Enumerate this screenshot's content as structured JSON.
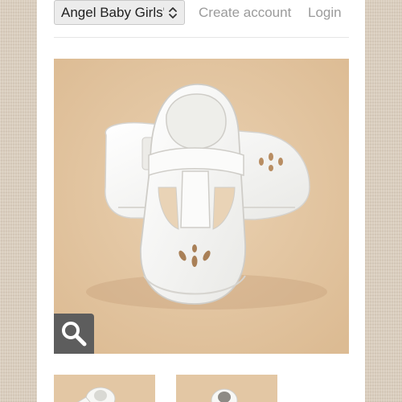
{
  "header": {
    "collection_select": {
      "selected": "Angel Baby Girls' Dot..."
    },
    "create_account_label": "Create account",
    "login_label": "Login"
  },
  "product_gallery": {
    "main_image": {
      "icon": "baby-tstrap-shoes-photo"
    },
    "zoom_icon": "magnifier-icon",
    "thumbnails": [
      {
        "icon": "shoe-thumbnail-1"
      },
      {
        "icon": "shoe-thumbnail-2"
      }
    ]
  },
  "colors": {
    "background_texture": "#d9cdbd",
    "photo_background": "#e3c7a4",
    "link_gray": "#9b9b9b",
    "zoom_button": "#5d5d5d"
  }
}
